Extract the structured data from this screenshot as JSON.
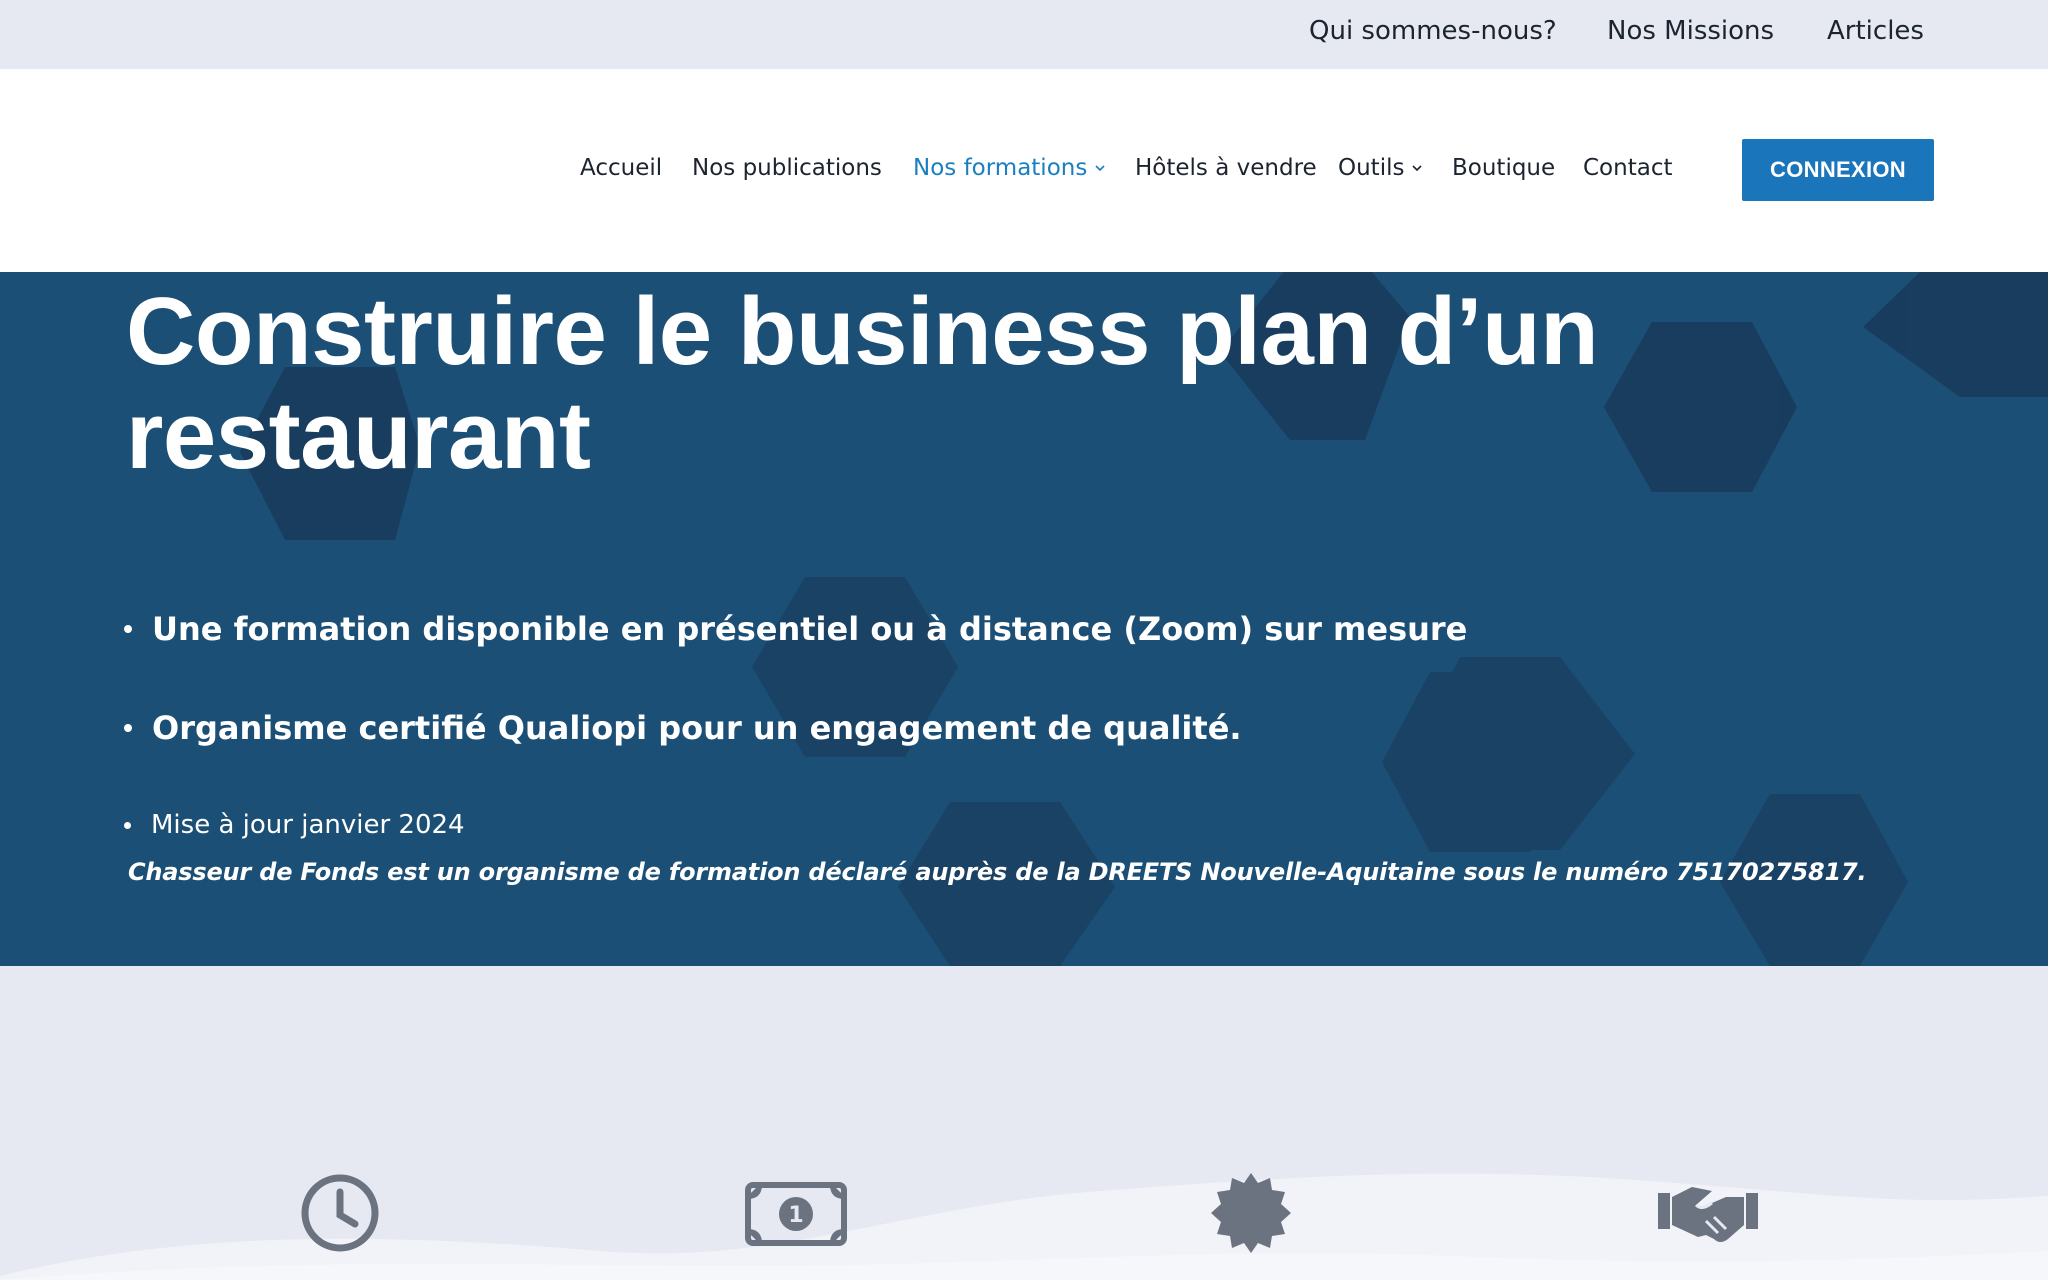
{
  "topbar": {
    "links": [
      "Qui sommes-nous?",
      "Nos Missions",
      "Articles"
    ]
  },
  "nav": {
    "items": [
      {
        "label": "Accueil"
      },
      {
        "label": "Nos publications"
      },
      {
        "label": "Nos formations"
      },
      {
        "label": "Hôtels à vendre"
      },
      {
        "label": "Outils"
      },
      {
        "label": "Boutique"
      },
      {
        "label": "Contact"
      }
    ],
    "active": "Nos formations",
    "login_label": "CONNEXION"
  },
  "hero": {
    "title_line1": "Construire le business plan d’un",
    "title_line2": "restaurant",
    "bullets": [
      "Une formation disponible en présentiel ou à distance (Zoom) sur mesure",
      "Organisme certifié Qualiopi pour un engagement de qualité.",
      "Mise à jour janvier 2024"
    ],
    "legal": "Chasseur de Fonds est un organisme de formation déclaré auprès de la DREETS Nouvelle-Aquitaine sous le numéro 75170275817."
  },
  "features": {
    "icons": [
      "clock-icon",
      "banknote-icon",
      "badge-icon",
      "handshake-icon"
    ]
  },
  "colors": {
    "accent": "#1a7fc1",
    "button": "#1b75bb",
    "hero_bg": "#1b4f75",
    "page_bg": "#e6e9f1",
    "icon_gray": "#6b7280"
  }
}
